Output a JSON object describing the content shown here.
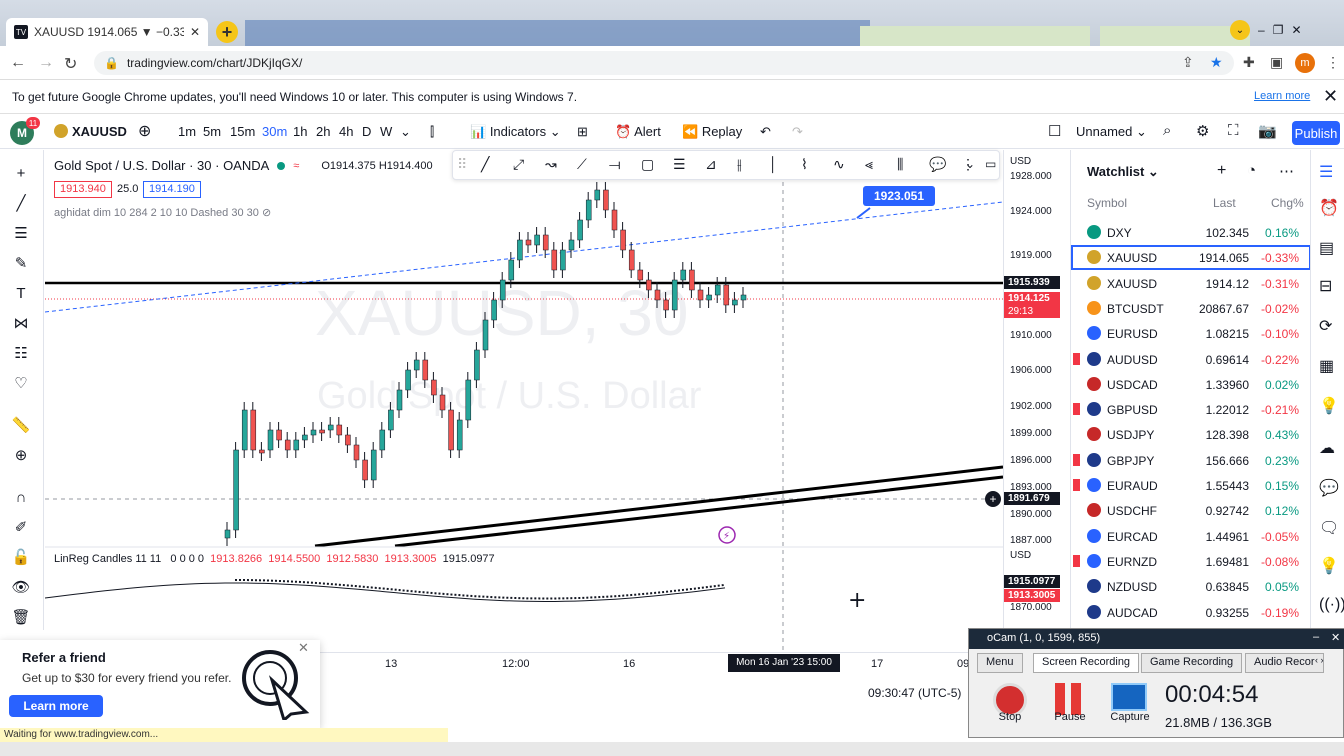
{
  "browser": {
    "tab_title": "XAUUSD 1914.065 ▼ −0.33% Un",
    "url": "tradingview.com/chart/JDKjIqGX/",
    "profile_initial": "m",
    "info_message": "To get future Google Chrome updates, you'll need Windows 10 or later. This computer is using Windows 7.",
    "info_link": "Learn more",
    "status_text": "Waiting for www.tradingview.com..."
  },
  "toolbar": {
    "avatar_letter": "M",
    "notif_count": "11",
    "symbol": "XAUUSD",
    "intervals": [
      "1m",
      "5m",
      "15m",
      "30m",
      "1h",
      "2h",
      "4h",
      "D",
      "W"
    ],
    "active_interval": "30m",
    "indicators_label": "Indicators",
    "alert_label": "Alert",
    "replay_label": "Replay",
    "layout_name": "Unnamed",
    "publish_label": "Publish"
  },
  "chart": {
    "title": "Gold Spot / U.S. Dollar · 30 · OANDA",
    "ohlc": "O1914.375  H1914.400",
    "sell_price": "1913.940",
    "spread": "25.0",
    "buy_price": "1914.190",
    "indicator1": "aghidat dim 10 284 2 10 10 Dashed 30 30",
    "watermark_symbol": "XAUUSD, 30",
    "watermark_name": "Gold Spot / U.S. Dollar",
    "linreg_label": "LinReg Candles 11 11",
    "linreg_flags": "0 0 0 0",
    "linreg_values": [
      "1913.8266",
      "1914.5500",
      "1912.5830",
      "1913.3005"
    ],
    "linreg_last": "1915.0977",
    "currency": "USD",
    "price_ticks": [
      "1928.000",
      "1924.000",
      "1919.000",
      "1910.000",
      "1906.000",
      "1902.000",
      "1899.000",
      "1896.000",
      "1893.000",
      "1890.000",
      "1887.000",
      "1870.000"
    ],
    "label_hline": "1915.939",
    "label_last": "1914.125",
    "label_countdown": "29:13",
    "label_cross": "1891.679",
    "label_trend": "1923.051",
    "label_ind_top": "1915.0977",
    "label_ind_bot": "1913.3005",
    "time_ticks": [
      "13",
      "12:00",
      "16",
      "17",
      "09"
    ],
    "crosshair_time": "Mon 16 Jan '23   15:00",
    "clock": "09:30:47 (UTC-5)"
  },
  "watchlist": {
    "title": "Watchlist",
    "col_symbol": "Symbol",
    "col_last": "Last",
    "col_chg": "Chg%",
    "rows": [
      {
        "symbol": "DXY",
        "last": "102.345",
        "chg": "0.16%",
        "dir": "up",
        "color": "#089981",
        "flag": false
      },
      {
        "symbol": "XAUUSD",
        "last": "1914.065",
        "chg": "-0.33%",
        "dir": "dn",
        "color": "#d1a32a",
        "flag": false
      },
      {
        "symbol": "XAUUSD",
        "last": "1914.12",
        "chg": "-0.31%",
        "dir": "dn",
        "color": "#d1a32a",
        "flag": false
      },
      {
        "symbol": "BTCUSDT",
        "last": "20867.67",
        "chg": "-0.02%",
        "dir": "dn",
        "color": "#f7931a",
        "flag": false
      },
      {
        "symbol": "EURUSD",
        "last": "1.08215",
        "chg": "-0.10%",
        "dir": "dn",
        "color": "#2962ff",
        "flag": false
      },
      {
        "symbol": "AUDUSD",
        "last": "0.69614",
        "chg": "-0.22%",
        "dir": "dn",
        "color": "#1e3a8a",
        "flag": true
      },
      {
        "symbol": "USDCAD",
        "last": "1.33960",
        "chg": "0.02%",
        "dir": "up",
        "color": "#c62828",
        "flag": false
      },
      {
        "symbol": "GBPUSD",
        "last": "1.22012",
        "chg": "-0.21%",
        "dir": "dn",
        "color": "#1e3a8a",
        "flag": true
      },
      {
        "symbol": "USDJPY",
        "last": "128.398",
        "chg": "0.43%",
        "dir": "up",
        "color": "#c62828",
        "flag": false
      },
      {
        "symbol": "GBPJPY",
        "last": "156.666",
        "chg": "0.23%",
        "dir": "up",
        "color": "#1e3a8a",
        "flag": true
      },
      {
        "symbol": "EURAUD",
        "last": "1.55443",
        "chg": "0.15%",
        "dir": "up",
        "color": "#2962ff",
        "flag": true
      },
      {
        "symbol": "USDCHF",
        "last": "0.92742",
        "chg": "0.12%",
        "dir": "up",
        "color": "#c62828",
        "flag": false
      },
      {
        "symbol": "EURCAD",
        "last": "1.44961",
        "chg": "-0.05%",
        "dir": "dn",
        "color": "#2962ff",
        "flag": false
      },
      {
        "symbol": "EURNZD",
        "last": "1.69481",
        "chg": "-0.08%",
        "dir": "dn",
        "color": "#2962ff",
        "flag": true
      },
      {
        "symbol": "NZDUSD",
        "last": "0.63845",
        "chg": "0.05%",
        "dir": "up",
        "color": "#1e3a8a",
        "flag": false
      },
      {
        "symbol": "AUDCAD",
        "last": "0.93255",
        "chg": "-0.19%",
        "dir": "dn",
        "color": "#1e3a8a",
        "flag": false
      }
    ]
  },
  "refer": {
    "title": "Refer a friend",
    "text": "Get up to $30 for every friend you refer.",
    "button": "Learn more"
  },
  "ocam": {
    "title": "oCam (1, 0, 1599, 855)",
    "menu": "Menu",
    "tabs": [
      "Screen Recording",
      "Game Recording",
      "Audio Recor"
    ],
    "stop": "Stop",
    "pause": "Pause",
    "capture": "Capture",
    "elapsed": "00:04:54",
    "size": "21.8MB / 136.3GB"
  }
}
